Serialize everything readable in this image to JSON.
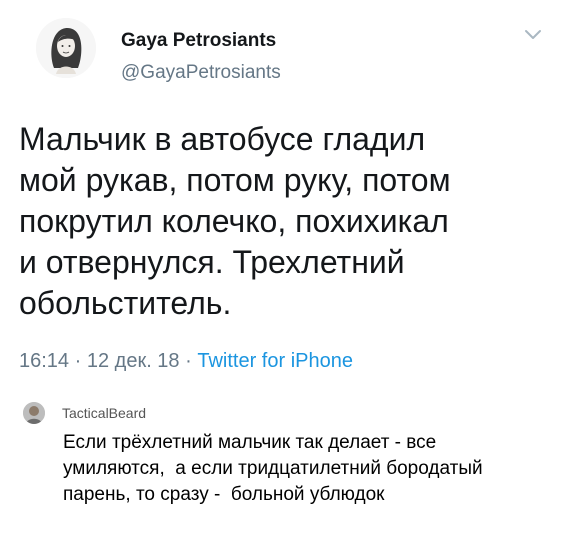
{
  "tweet": {
    "author_name": "Gaya Petrosiants",
    "author_handle": "@GayaPetrosiants",
    "text_lines": [
      "Мальчик в автобусе гладил",
      "мой рукав, потом руку, потом",
      "покрутил колечко, похихикал",
      "и отвернулся. Трехлетний",
      "обольститель."
    ],
    "time": "16:14",
    "separator": " · ",
    "date": "12 дек. 18",
    "source": "Twitter for iPhone",
    "menu_icon": "chevron-down-icon",
    "avatar_icon": "avatar-illustration"
  },
  "comment": {
    "author": "TacticalBeard",
    "avatar_icon": "avatar-photo",
    "text_lines": [
      "Если трёхлетний мальчик так делает - все",
      "умиляются,  а если тридцатилетний бородатый",
      "парень, то сразу -  больной ублюдок"
    ]
  },
  "colors": {
    "primary_text": "#14171a",
    "secondary_text": "#657786",
    "link": "#1b95e0"
  }
}
